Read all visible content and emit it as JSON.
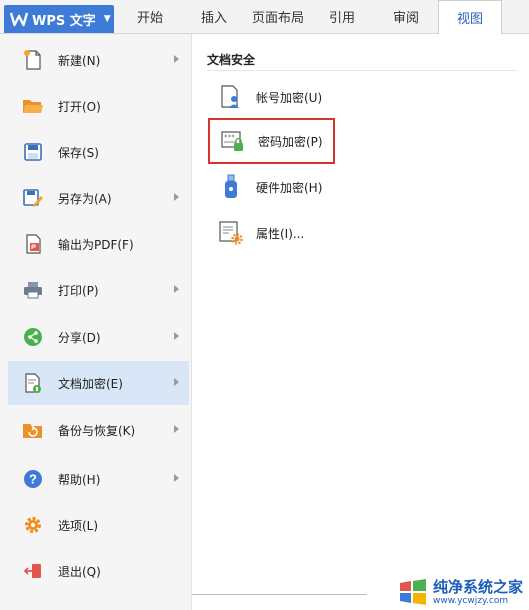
{
  "app": {
    "title": "WPS 文字"
  },
  "ribbon": {
    "tabs": [
      {
        "label": "开始"
      },
      {
        "label": "插入"
      },
      {
        "label": "页面布局"
      },
      {
        "label": "引用"
      },
      {
        "label": "审阅"
      },
      {
        "label": "视图",
        "active": true
      }
    ]
  },
  "menu": {
    "items": [
      {
        "label": "新建(N)",
        "icon": "new-file-icon",
        "submenu": true
      },
      {
        "label": "打开(O)",
        "icon": "open-folder-icon",
        "submenu": false
      },
      {
        "label": "保存(S)",
        "icon": "save-icon",
        "submenu": false
      },
      {
        "label": "另存为(A)",
        "icon": "save-as-icon",
        "submenu": true
      },
      {
        "label": "输出为PDF(F)",
        "icon": "pdf-icon",
        "submenu": false
      },
      {
        "label": "打印(P)",
        "icon": "printer-icon",
        "submenu": true
      },
      {
        "label": "分享(D)",
        "icon": "share-icon",
        "submenu": true
      },
      {
        "label": "文档加密(E)",
        "icon": "doc-encrypt-icon",
        "submenu": true,
        "active": true
      },
      {
        "label": "备份与恢复(K)",
        "icon": "backup-icon",
        "submenu": true
      },
      {
        "label": "帮助(H)",
        "icon": "help-icon",
        "submenu": true
      },
      {
        "label": "选项(L)",
        "icon": "gear-icon",
        "submenu": false
      },
      {
        "label": "退出(Q)",
        "icon": "exit-icon",
        "submenu": false
      }
    ]
  },
  "panel": {
    "title": "文档安全",
    "items": [
      {
        "label": "帐号加密(U)",
        "icon": "account-lock-icon"
      },
      {
        "label": "密码加密(P)",
        "icon": "password-lock-icon",
        "highlighted": true
      },
      {
        "label": "硬件加密(H)",
        "icon": "usb-key-icon"
      },
      {
        "label": "属性(I)...",
        "icon": "doc-properties-icon"
      }
    ]
  },
  "watermark": {
    "line1": "纯净系统之家",
    "line2": "www.ycwjzy.com"
  },
  "colors": {
    "accent": "#3d7bd6",
    "highlight_border": "#d8322c",
    "active_item_bg": "#d9e6f7"
  }
}
